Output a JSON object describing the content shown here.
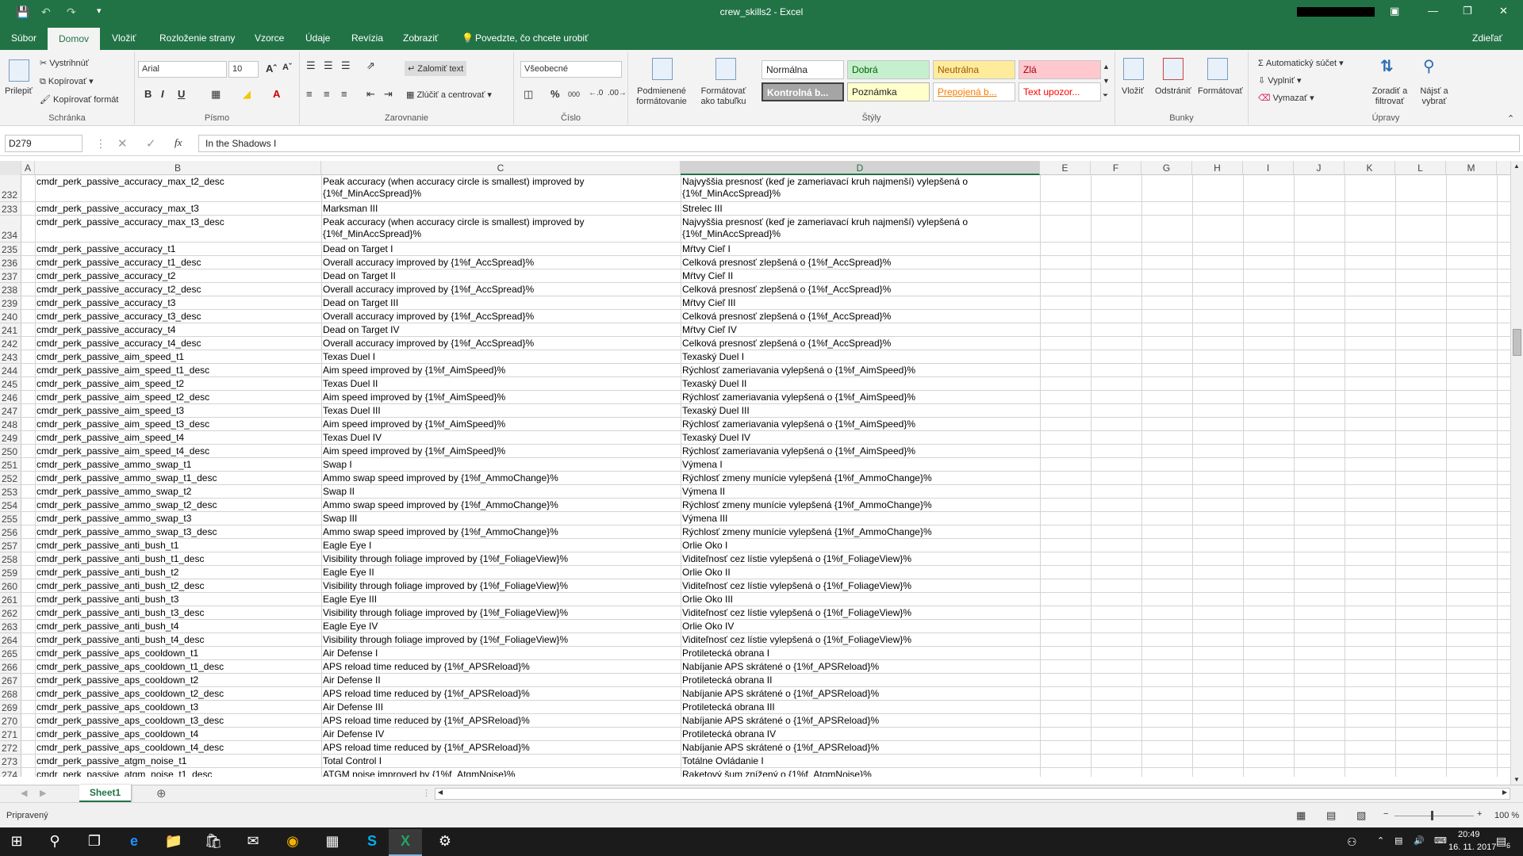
{
  "window": {
    "title": "crew_skills2 - Excel"
  },
  "menu": {
    "tabs": [
      "Súbor",
      "Domov",
      "Vložiť",
      "Rozloženie strany",
      "Vzorce",
      "Údaje",
      "Revízia",
      "Zobraziť"
    ],
    "tell_me": "Povedzte, čo chcete urobiť",
    "share": "Zdieľať"
  },
  "ribbon": {
    "clipboard": {
      "label": "Schránka",
      "paste": "Prilepiť",
      "cut": "Vystrihnúť",
      "copy": "Kopírovať",
      "format_painter": "Kopírovať formát"
    },
    "font": {
      "label": "Písmo",
      "name": "Arial",
      "size": "10"
    },
    "alignment": {
      "label": "Zarovnanie",
      "wrap": "Zalomiť text",
      "merge": "Zlúčiť a centrovať"
    },
    "number": {
      "label": "Číslo",
      "format": "Všeobecné"
    },
    "styles": {
      "label": "Štýly",
      "cond_format": "Podmienené formátovanie",
      "format_table": "Formátovať ako tabuľku",
      "normal": "Normálna",
      "good": "Dobrá",
      "neutral": "Neutrálna",
      "bad": "Zlá",
      "check": "Kontrolná b...",
      "note": "Poznámka",
      "linked": "Prepojená b...",
      "warning": "Text upozor..."
    },
    "cells": {
      "label": "Bunky",
      "insert": "Vložiť",
      "delete": "Odstrániť",
      "format": "Formátovať"
    },
    "editing": {
      "label": "Úpravy",
      "autosum": "Automatický súčet",
      "fill": "Vyplniť",
      "clear": "Vymazať",
      "sort": "Zoradiť a filtrovať",
      "find": "Nájsť a vybrať"
    }
  },
  "formula_bar": {
    "name_box": "D279",
    "formula": "In the Shadows I"
  },
  "columns": [
    "A",
    "B",
    "C",
    "D",
    "E",
    "F",
    "G",
    "H",
    "I",
    "J",
    "K",
    "L",
    "M"
  ],
  "rows": [
    {
      "n": "232",
      "b": "cmdr_perk_passive_accuracy_max_t2_desc",
      "c": "Peak accuracy (when accuracy circle is smallest) improved by {1%f_MinAccSpread}%",
      "d": "Najvyššia presnosť (keď je zameriavací kruh najmenší) vylepšená o {1%f_MinAccSpread}%",
      "tall": true
    },
    {
      "n": "233",
      "b": "cmdr_perk_passive_accuracy_max_t3",
      "c": "Marksman III",
      "d": "Strelec III"
    },
    {
      "n": "234",
      "b": "cmdr_perk_passive_accuracy_max_t3_desc",
      "c": "Peak accuracy (when accuracy circle is smallest) improved by {1%f_MinAccSpread}%",
      "d": "Najvyššia presnosť (keď je zameriavací kruh najmenší) vylepšená o {1%f_MinAccSpread}%",
      "tall": true
    },
    {
      "n": "235",
      "b": "cmdr_perk_passive_accuracy_t1",
      "c": "Dead on Target I",
      "d": "Mŕtvy Cieľ I"
    },
    {
      "n": "236",
      "b": "cmdr_perk_passive_accuracy_t1_desc",
      "c": "Overall accuracy improved by {1%f_AccSpread}%",
      "d": "Celková presnosť zlepšená o {1%f_AccSpread}%"
    },
    {
      "n": "237",
      "b": "cmdr_perk_passive_accuracy_t2",
      "c": "Dead on Target II",
      "d": "Mŕtvy Cieľ II"
    },
    {
      "n": "238",
      "b": "cmdr_perk_passive_accuracy_t2_desc",
      "c": "Overall accuracy improved by {1%f_AccSpread}%",
      "d": "Celková presnosť zlepšená o {1%f_AccSpread}%"
    },
    {
      "n": "239",
      "b": "cmdr_perk_passive_accuracy_t3",
      "c": "Dead on Target III",
      "d": "Mŕtvy Cieľ III"
    },
    {
      "n": "240",
      "b": "cmdr_perk_passive_accuracy_t3_desc",
      "c": "Overall accuracy improved by {1%f_AccSpread}%",
      "d": "Celková presnosť zlepšená o {1%f_AccSpread}%"
    },
    {
      "n": "241",
      "b": "cmdr_perk_passive_accuracy_t4",
      "c": "Dead on Target IV",
      "d": "Mŕtvy Cieľ IV"
    },
    {
      "n": "242",
      "b": "cmdr_perk_passive_accuracy_t4_desc",
      "c": "Overall accuracy improved by {1%f_AccSpread}%",
      "d": "Celková presnosť zlepšená o {1%f_AccSpread}%"
    },
    {
      "n": "243",
      "b": "cmdr_perk_passive_aim_speed_t1",
      "c": "Texas Duel I",
      "d": "Texaský Duel I"
    },
    {
      "n": "244",
      "b": "cmdr_perk_passive_aim_speed_t1_desc",
      "c": "Aim speed improved by {1%f_AimSpeed}%",
      "d": "Rýchlosť zameriavania vylepšená o {1%f_AimSpeed}%"
    },
    {
      "n": "245",
      "b": "cmdr_perk_passive_aim_speed_t2",
      "c": "Texas Duel II",
      "d": "Texaský Duel II"
    },
    {
      "n": "246",
      "b": "cmdr_perk_passive_aim_speed_t2_desc",
      "c": "Aim speed improved by {1%f_AimSpeed}%",
      "d": "Rýchlosť zameriavania vylepšená o {1%f_AimSpeed}%"
    },
    {
      "n": "247",
      "b": "cmdr_perk_passive_aim_speed_t3",
      "c": "Texas Duel III",
      "d": "Texaský Duel III"
    },
    {
      "n": "248",
      "b": "cmdr_perk_passive_aim_speed_t3_desc",
      "c": "Aim speed improved by {1%f_AimSpeed}%",
      "d": "Rýchlosť zameriavania vylepšená o {1%f_AimSpeed}%"
    },
    {
      "n": "249",
      "b": "cmdr_perk_passive_aim_speed_t4",
      "c": "Texas Duel IV",
      "d": "Texaský Duel IV"
    },
    {
      "n": "250",
      "b": "cmdr_perk_passive_aim_speed_t4_desc",
      "c": "Aim speed improved by {1%f_AimSpeed}%",
      "d": "Rýchlosť zameriavania vylepšená o {1%f_AimSpeed}%"
    },
    {
      "n": "251",
      "b": "cmdr_perk_passive_ammo_swap_t1",
      "c": "Swap I",
      "d": "Výmena I"
    },
    {
      "n": "252",
      "b": "cmdr_perk_passive_ammo_swap_t1_desc",
      "c": "Ammo swap speed improved by {1%f_AmmoChange}%",
      "d": "Rýchlosť zmeny munície vylepšená {1%f_AmmoChange}%"
    },
    {
      "n": "253",
      "b": "cmdr_perk_passive_ammo_swap_t2",
      "c": "Swap II",
      "d": "Výmena II"
    },
    {
      "n": "254",
      "b": "cmdr_perk_passive_ammo_swap_t2_desc",
      "c": "Ammo swap speed improved by {1%f_AmmoChange}%",
      "d": "Rýchlosť zmeny munície vylepšená {1%f_AmmoChange}%"
    },
    {
      "n": "255",
      "b": "cmdr_perk_passive_ammo_swap_t3",
      "c": "Swap III",
      "d": "Výmena III"
    },
    {
      "n": "256",
      "b": "cmdr_perk_passive_ammo_swap_t3_desc",
      "c": "Ammo swap speed improved by {1%f_AmmoChange}%",
      "d": "Rýchlosť zmeny munície vylepšená {1%f_AmmoChange}%"
    },
    {
      "n": "257",
      "b": "cmdr_perk_passive_anti_bush_t1",
      "c": "Eagle Eye I",
      "d": "Orlie Oko I"
    },
    {
      "n": "258",
      "b": "cmdr_perk_passive_anti_bush_t1_desc",
      "c": "Visibility through foliage improved by {1%f_FoliageView}%",
      "d": "Viditeľnosť cez lístie vylepšená o {1%f_FoliageView}%"
    },
    {
      "n": "259",
      "b": "cmdr_perk_passive_anti_bush_t2",
      "c": "Eagle Eye II",
      "d": "Orlie Oko II"
    },
    {
      "n": "260",
      "b": "cmdr_perk_passive_anti_bush_t2_desc",
      "c": "Visibility through foliage improved by {1%f_FoliageView}%",
      "d": "Viditeľnosť cez lístie vylepšená o {1%f_FoliageView}%"
    },
    {
      "n": "261",
      "b": "cmdr_perk_passive_anti_bush_t3",
      "c": "Eagle Eye III",
      "d": "Orlie Oko III"
    },
    {
      "n": "262",
      "b": "cmdr_perk_passive_anti_bush_t3_desc",
      "c": "Visibility through foliage improved by {1%f_FoliageView}%",
      "d": "Viditeľnosť cez lístie vylepšená o {1%f_FoliageView}%"
    },
    {
      "n": "263",
      "b": "cmdr_perk_passive_anti_bush_t4",
      "c": "Eagle Eye IV",
      "d": "Orlie Oko IV"
    },
    {
      "n": "264",
      "b": "cmdr_perk_passive_anti_bush_t4_desc",
      "c": "Visibility through foliage improved by {1%f_FoliageView}%",
      "d": "Viditeľnosť cez lístie vylepšená o {1%f_FoliageView}%"
    },
    {
      "n": "265",
      "b": "cmdr_perk_passive_aps_cooldown_t1",
      "c": "Air Defense I",
      "d": "Protiletecká obrana I"
    },
    {
      "n": "266",
      "b": "cmdr_perk_passive_aps_cooldown_t1_desc",
      "c": "APS reload time reduced by {1%f_APSReload}%",
      "d": "Nabíjanie APS skrátené o {1%f_APSReload}%"
    },
    {
      "n": "267",
      "b": "cmdr_perk_passive_aps_cooldown_t2",
      "c": "Air Defense II",
      "d": "Protiletecká obrana II"
    },
    {
      "n": "268",
      "b": "cmdr_perk_passive_aps_cooldown_t2_desc",
      "c": "APS reload time reduced by {1%f_APSReload}%",
      "d": "Nabíjanie APS skrátené o {1%f_APSReload}%"
    },
    {
      "n": "269",
      "b": "cmdr_perk_passive_aps_cooldown_t3",
      "c": "Air Defense III",
      "d": "Protiletecká obrana III"
    },
    {
      "n": "270",
      "b": "cmdr_perk_passive_aps_cooldown_t3_desc",
      "c": "APS reload time reduced by {1%f_APSReload}%",
      "d": "Nabíjanie APS skrátené o {1%f_APSReload}%"
    },
    {
      "n": "271",
      "b": "cmdr_perk_passive_aps_cooldown_t4",
      "c": "Air Defense IV",
      "d": "Protiletecká obrana IV"
    },
    {
      "n": "272",
      "b": "cmdr_perk_passive_aps_cooldown_t4_desc",
      "c": "APS reload time reduced by {1%f_APSReload}%",
      "d": "Nabíjanie APS skrátené o {1%f_APSReload}%"
    },
    {
      "n": "273",
      "b": "cmdr_perk_passive_atgm_noise_t1",
      "c": "Total Control I",
      "d": "Totálne Ovládanie I"
    },
    {
      "n": "274",
      "b": "cmdr_perk_passive_atgm_noise_t1_desc",
      "c": "ATGM noise improved by {1%f_AtgmNoise}%",
      "d": "Raketový šum znížený o {1%f_AtgmNoise}%"
    }
  ],
  "sheet": {
    "tab": "Sheet1"
  },
  "status": {
    "ready": "Pripravený",
    "zoom": "100 %"
  },
  "taskbar": {
    "time": "20:49",
    "date": "16. 11. 2017",
    "notif_count": "6"
  }
}
